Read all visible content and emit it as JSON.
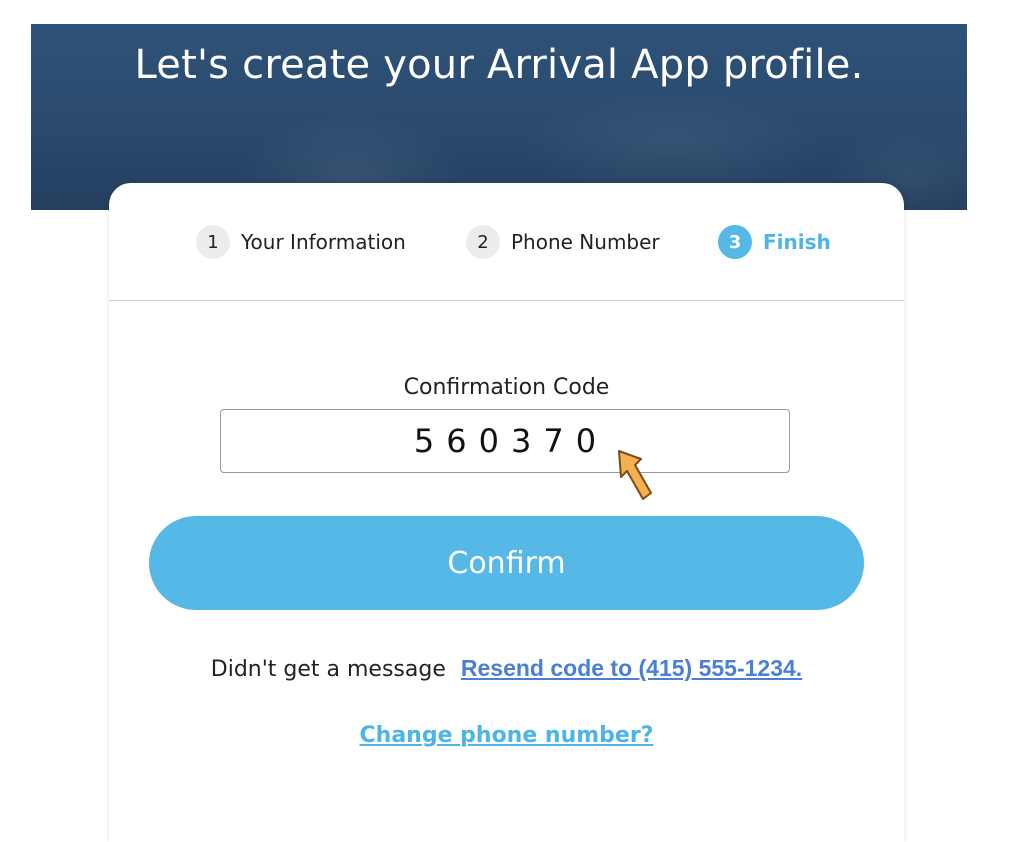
{
  "header": {
    "title": "Let's create your Arrival App profile."
  },
  "steps": [
    {
      "number": "1",
      "label": "Your Information"
    },
    {
      "number": "2",
      "label": "Phone Number"
    },
    {
      "number": "3",
      "label": "Finish"
    }
  ],
  "active_step": 3,
  "form": {
    "code_label": "Confirmation Code",
    "code_value": "560370",
    "confirm_label": "Confirm"
  },
  "resend": {
    "prompt": "Didn't get a message",
    "link_text": "Resend code to (415) 555-1234."
  },
  "change_phone": {
    "link_text": "Change phone number?"
  },
  "colors": {
    "accent": "#55b8e6",
    "link_blue": "#4a7fd6",
    "hero_bg": "#2c4e72",
    "pointer_arrow": "#f5b052"
  }
}
